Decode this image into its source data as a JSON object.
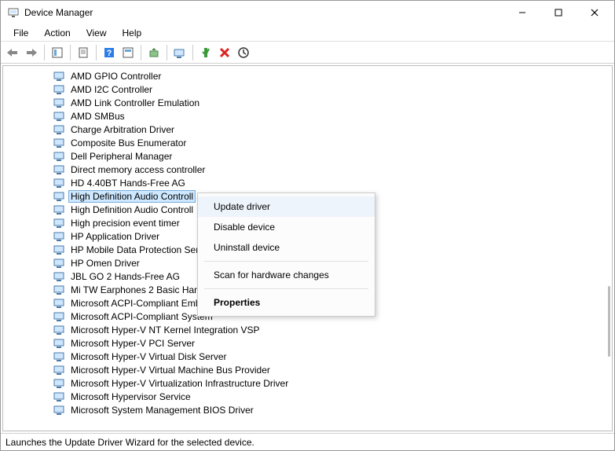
{
  "window": {
    "title": "Device Manager"
  },
  "menu": {
    "file": "File",
    "action": "Action",
    "view": "View",
    "help": "Help"
  },
  "devices": [
    "AMD GPIO Controller",
    "AMD I2C Controller",
    "AMD Link Controller Emulation",
    "AMD SMBus",
    "Charge Arbitration Driver",
    "Composite Bus Enumerator",
    "Dell Peripheral Manager",
    "Direct memory access controller",
    "HD 4.40BT Hands-Free AG",
    "High Definition Audio Controll",
    "High Definition Audio Controll",
    "High precision event timer",
    "HP Application Driver",
    "HP Mobile Data Protection Ser",
    "HP Omen Driver",
    "JBL GO 2 Hands-Free AG",
    "Mi TW Earphones 2 Basic Hands-Free AG",
    "Microsoft ACPI-Compliant Embedded Controller",
    "Microsoft ACPI-Compliant System",
    "Microsoft Hyper-V NT Kernel Integration VSP",
    "Microsoft Hyper-V PCI Server",
    "Microsoft Hyper-V Virtual Disk Server",
    "Microsoft Hyper-V Virtual Machine Bus Provider",
    "Microsoft Hyper-V Virtualization Infrastructure Driver",
    "Microsoft Hypervisor Service",
    "Microsoft System Management BIOS Driver"
  ],
  "selected_index": 9,
  "context_menu": {
    "update": "Update driver",
    "disable": "Disable device",
    "uninstall": "Uninstall device",
    "scan": "Scan for hardware changes",
    "properties": "Properties"
  },
  "status": "Launches the Update Driver Wizard for the selected device."
}
